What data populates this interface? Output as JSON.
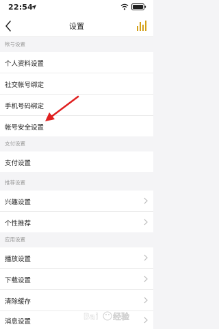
{
  "status_bar": {
    "time": "22:54"
  },
  "nav": {
    "title": "设置"
  },
  "sections": [
    {
      "title": "帐号设置",
      "items": [
        {
          "label": "个人资料设置"
        },
        {
          "label": "社交帐号绑定"
        },
        {
          "label": "手机号码绑定"
        },
        {
          "label": "帐号安全设置"
        }
      ]
    },
    {
      "title": "支付设置",
      "items": [
        {
          "label": "支付设置"
        }
      ]
    },
    {
      "title": "推荐设置",
      "items": [
        {
          "label": "兴趣设置"
        },
        {
          "label": "个性推荐"
        }
      ]
    },
    {
      "title": "应用设置",
      "items": [
        {
          "label": "播放设置"
        },
        {
          "label": "下载设置"
        },
        {
          "label": "清除缓存"
        },
        {
          "label": "消息设置"
        }
      ]
    }
  ],
  "colors": {
    "accent": "#d4a017",
    "arrow": "#e02020",
    "text": "#222222",
    "section_text": "#9a9a9a",
    "background": "#f4f4f6"
  },
  "icons": {
    "back": "chevron-left-icon",
    "nav_right": "bars-chart-icon",
    "row": "chevron-right-icon"
  },
  "watermark": {
    "text": "Baidu 经验"
  }
}
